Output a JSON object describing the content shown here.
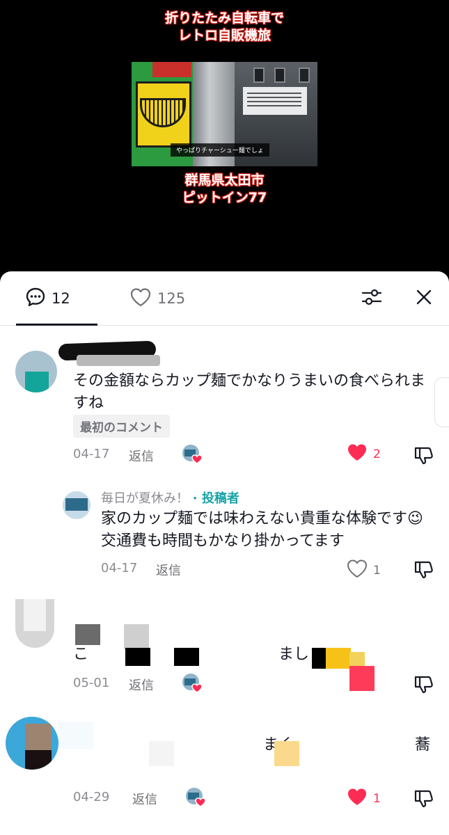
{
  "video": {
    "caption_top_line1": "折りたたみ自転車で",
    "caption_top_line2": "レトロ自販機旅",
    "caption_bottom_line1": "群馬県太田市",
    "caption_bottom_line2": "ピットイン77",
    "subtitle": "やっぱりチャーシュー麺でしょ"
  },
  "tabs": {
    "comments_count": "12",
    "likes_count": "125"
  },
  "comments": [
    {
      "text": "その金額ならカップ麺でかなりうまいの食べられますね",
      "badge": "最初のコメント",
      "date": "04-17",
      "reply_label": "返信",
      "like_count": "2",
      "liked": true
    },
    {
      "name": "毎日が夏休み！",
      "author_tag": "· 投稿者",
      "text": "家のカップ麺では味わえない貴重な体験です😉交通費も時間もかなり掛かってます",
      "date": "04-17",
      "reply_label": "返信",
      "like_count": "1",
      "liked": false
    },
    {
      "text_visible_start": "こ",
      "text_visible_end": "まし",
      "date": "05-01",
      "reply_label": "返信"
    },
    {
      "text_visible_mid": "まく",
      "text_visible_end": "蕎",
      "date": "04-29",
      "reply_label": "返信",
      "like_count": "1",
      "liked": true
    }
  ],
  "colors": {
    "author_accent": "#1aa3a8",
    "like_red": "#fe2c55",
    "caption_outline": "#d4231a"
  }
}
